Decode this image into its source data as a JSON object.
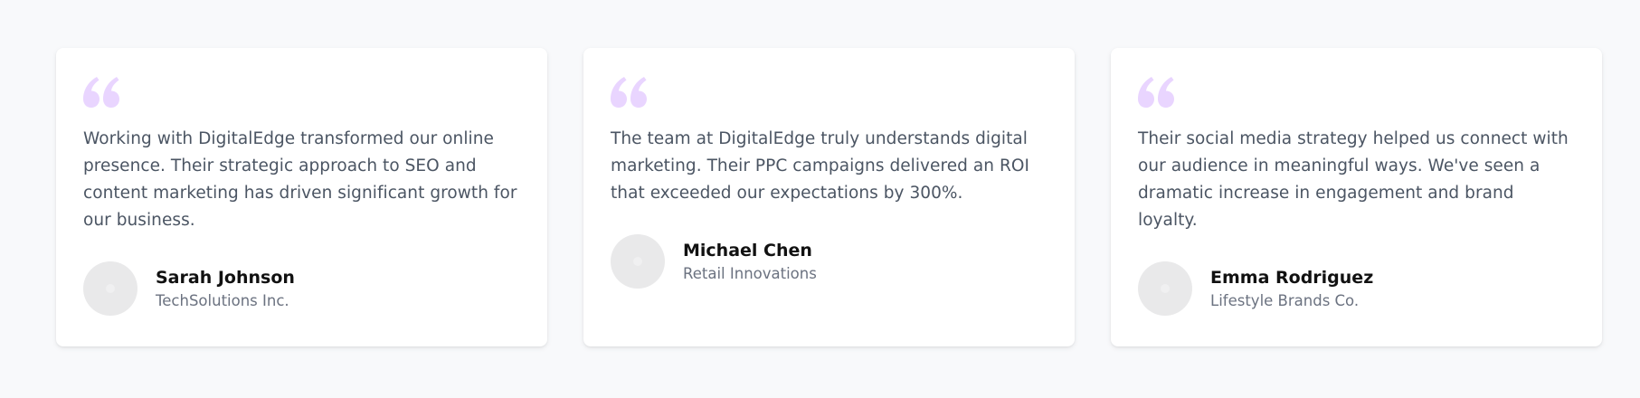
{
  "colors": {
    "background": "#f8f9fb",
    "card": "#ffffff",
    "quote_mark": "#e9d5ff",
    "body_text": "#4b5563",
    "name_text": "#111111",
    "company_text": "#6b7280",
    "avatar_placeholder": "#e9e9ea"
  },
  "testimonials": [
    {
      "quote_icon": "quote-icon",
      "text": "Working with DigitalEdge transformed our online presence. Their strategic approach to SEO and content marketing has driven significant growth for our business.",
      "name": "Sarah Johnson",
      "company": "TechSolutions Inc."
    },
    {
      "quote_icon": "quote-icon",
      "text": "The team at DigitalEdge truly understands digital marketing. Their PPC campaigns delivered an ROI that exceeded our expectations by 300%.",
      "name": "Michael Chen",
      "company": "Retail Innovations"
    },
    {
      "quote_icon": "quote-icon",
      "text": "Their social media strategy helped us connect with our audience in meaningful ways. We've seen a dramatic increase in engagement and brand loyalty.",
      "name": "Emma Rodriguez",
      "company": "Lifestyle Brands Co."
    }
  ]
}
